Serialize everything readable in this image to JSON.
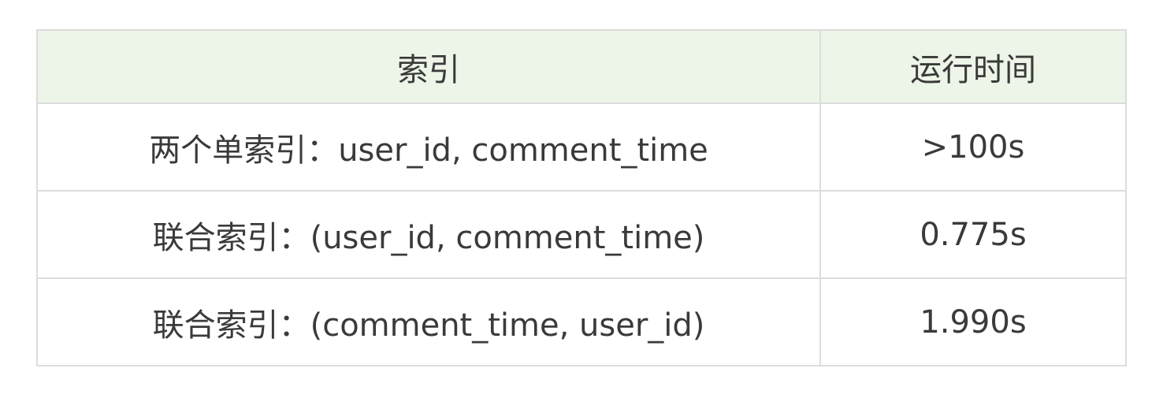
{
  "table": {
    "headers": [
      "索引",
      "运行时间"
    ],
    "rows": [
      [
        "两个单索引：user_id, comment_time",
        ">100s"
      ],
      [
        "联合索引：(user_id, comment_time)",
        "0.775s"
      ],
      [
        "联合索引：(comment_time, user_id)",
        "1.990s"
      ]
    ]
  },
  "colors": {
    "header_bg": "#edf4e8",
    "border": "#dcdcdc",
    "text": "#3a3a3a"
  }
}
